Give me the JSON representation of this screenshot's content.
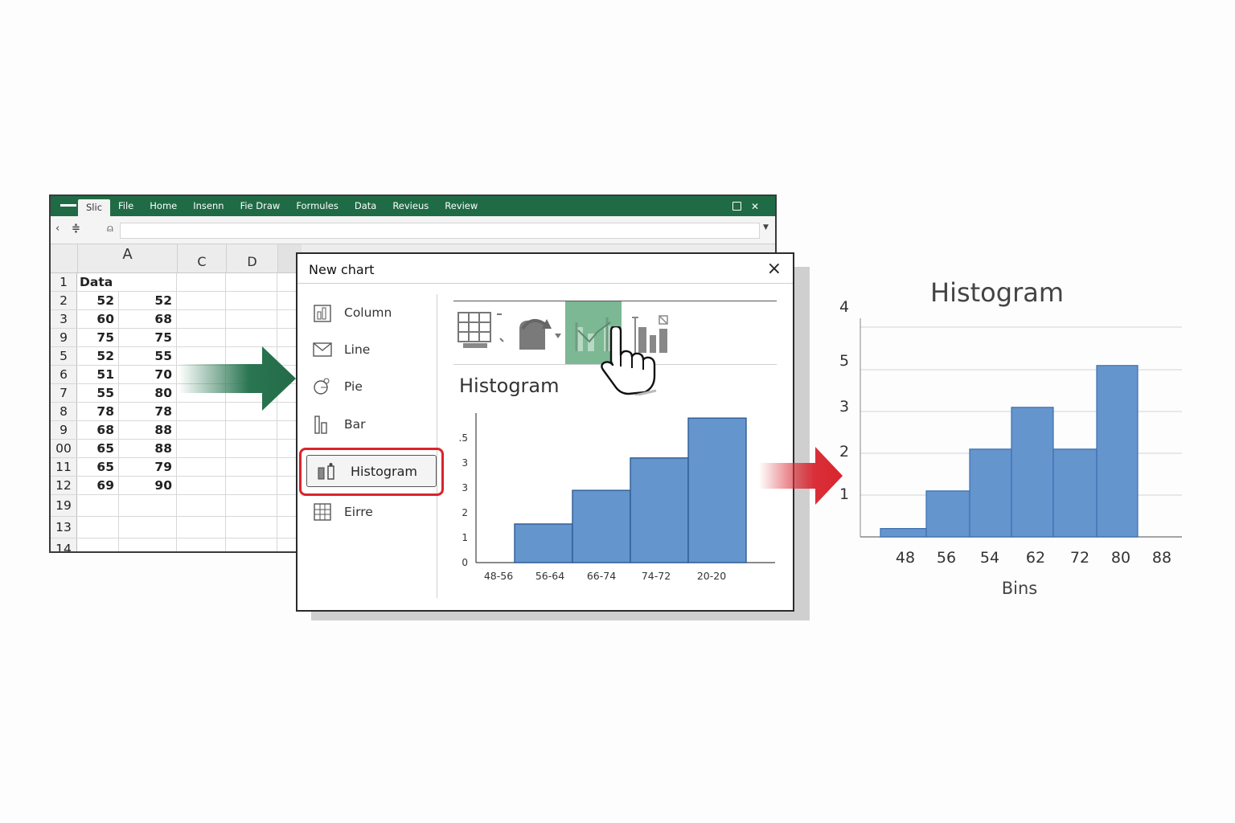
{
  "window": {
    "tabs": [
      "Slic",
      "File",
      "Home",
      "Insenn",
      "Fie Draw",
      "Formules",
      "Data",
      "Revieus",
      "Review"
    ],
    "active_tab": 0,
    "columns": [
      "A",
      "C",
      "D"
    ],
    "rows": [
      {
        "num": "1",
        "a": "Data",
        "b": ""
      },
      {
        "num": "2",
        "a": "52",
        "b": "52"
      },
      {
        "num": "3",
        "a": "60",
        "b": "68"
      },
      {
        "num": "9",
        "a": "75",
        "b": "75"
      },
      {
        "num": "5",
        "a": "52",
        "b": "55"
      },
      {
        "num": "6",
        "a": "51",
        "b": "70"
      },
      {
        "num": "7",
        "a": "55",
        "b": "80"
      },
      {
        "num": "8",
        "a": "78",
        "b": "78"
      },
      {
        "num": "9",
        "a": "68",
        "b": "88"
      },
      {
        "num": "00",
        "a": "65",
        "b": "88"
      },
      {
        "num": "11",
        "a": "65",
        "b": "79"
      },
      {
        "num": "12",
        "a": "69",
        "b": "90"
      },
      {
        "num": "19",
        "a": "",
        "b": ""
      },
      {
        "num": "13",
        "a": "",
        "b": ""
      },
      {
        "num": "14",
        "a": "",
        "b": ""
      }
    ]
  },
  "dialog": {
    "title": "New chart",
    "close_label": "×",
    "chart_types": [
      {
        "label": "Column",
        "icon": "column-chart-icon"
      },
      {
        "label": "Line",
        "icon": "line-chart-icon"
      },
      {
        "label": "Pie",
        "icon": "pie-chart-icon"
      },
      {
        "label": "Bar",
        "icon": "bar-chart-icon"
      },
      {
        "label": "Histogram",
        "icon": "histogram-icon",
        "selected": true
      },
      {
        "label": "Eirre",
        "icon": "grid-icon"
      }
    ],
    "gallery": [
      "table-chart-icon",
      "rotate-chart-icon",
      "histogram-line-icon",
      "histogram-bars-icon"
    ],
    "gallery_selected": 2,
    "preview_title": "Histogram",
    "selection_color": "#7bb893",
    "highlight_color": "#d9242d"
  },
  "chart_data": [
    {
      "type": "bar",
      "title": "Histogram",
      "xlabel": "",
      "ylabel": "",
      "categories": [
        "48-56",
        "56-64",
        "66-74",
        "74-72",
        "20-20"
      ],
      "values": [
        1.55,
        2.9,
        4.2,
        5.8
      ],
      "y_ticks": [
        "0",
        "1",
        "2",
        "3",
        "3",
        ".5"
      ],
      "ylim": [
        0,
        6
      ],
      "color": "#6495cd"
    },
    {
      "type": "bar",
      "title": "Histogram",
      "xlabel": "Bins",
      "ylabel": "",
      "categories": [
        "48",
        "56",
        "54",
        "62",
        "72",
        "80",
        "88"
      ],
      "values": [
        0.2,
        1.1,
        2.1,
        3.1,
        2.1,
        4.1
      ],
      "y_ticks": [
        "1",
        "2",
        "3",
        "5",
        "4"
      ],
      "ylim": [
        0,
        5.2
      ],
      "grid": true,
      "color": "#6495cd"
    }
  ]
}
